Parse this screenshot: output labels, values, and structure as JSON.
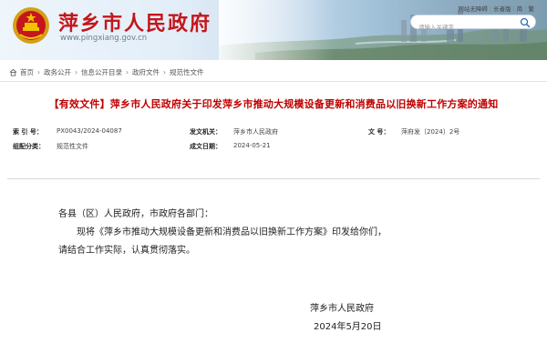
{
  "header": {
    "site_title": "萍乡市人民政府",
    "site_url": "www.pingxiang.gov.cn",
    "top_links": [
      "网站无障碍",
      "长者版",
      "简",
      "繁"
    ],
    "search_placeholder": "请输入关键字"
  },
  "breadcrumb": [
    "首页",
    "政务公开",
    "信息公开目录",
    "政府文件",
    "规范性文件"
  ],
  "document": {
    "title": "【有效文件】萍乡市人民政府关于印发萍乡市推动大规模设备更新和消费品以旧换新工作方案的通知",
    "meta": {
      "index_label": "索 引 号：",
      "index_value": "PX0043/2024-04087",
      "publisher_label": "发文机关：",
      "publisher_value": "萍乡市人民政府",
      "docno_label": "文  号：",
      "docno_value": "萍府发〔2024〕2号",
      "category_label": "组配分类：",
      "category_value": "规范性文件",
      "date_label": "成文日期：",
      "date_value": "2024-05-21"
    },
    "body": {
      "salutation": "各县（区）人民政府，市政府各部门：",
      "para1": "现将《萍乡市推动大规模设备更新和消费品以旧换新工作方案》印发给你们，",
      "para2": "请结合工作实际，认真贯彻落实。",
      "signature": "萍乡市人民政府",
      "sign_date": "2024年5月20日"
    }
  },
  "colors": {
    "title_red": "#c4161c",
    "doc_title_red": "#c00000"
  }
}
